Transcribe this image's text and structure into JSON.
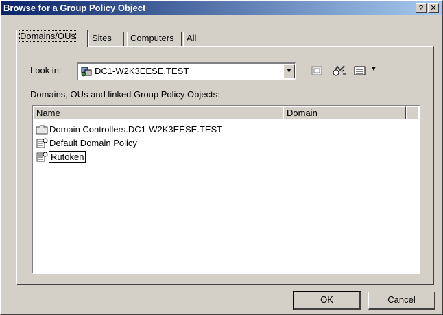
{
  "window": {
    "title": "Browse for a Group Policy Object",
    "help_glyph": "?",
    "close_glyph": "✕"
  },
  "tabs": [
    {
      "label": "Domains/OUs",
      "active": true
    },
    {
      "label": "Sites"
    },
    {
      "label": "Computers"
    },
    {
      "label": "All"
    }
  ],
  "look_in": {
    "label": "Look in:",
    "value": "DC1-W2K3EESE.TEST"
  },
  "section_label": "Domains, OUs and linked Group Policy Objects:",
  "columns": [
    "Name",
    "Domain"
  ],
  "rows": [
    {
      "name": "Domain Controllers.DC1-W2K3EESE.TEST",
      "icon": "folder-icon"
    },
    {
      "name": "Default Domain Policy",
      "icon": "gpo-icon"
    },
    {
      "name": "Rutoken",
      "icon": "gpo-icon",
      "selected": true
    }
  ],
  "buttons": {
    "ok": "OK",
    "cancel": "Cancel"
  },
  "colors": {
    "titlebar_start": "#0a246a",
    "titlebar_end": "#a6caf0",
    "face": "#d4d0c8"
  }
}
